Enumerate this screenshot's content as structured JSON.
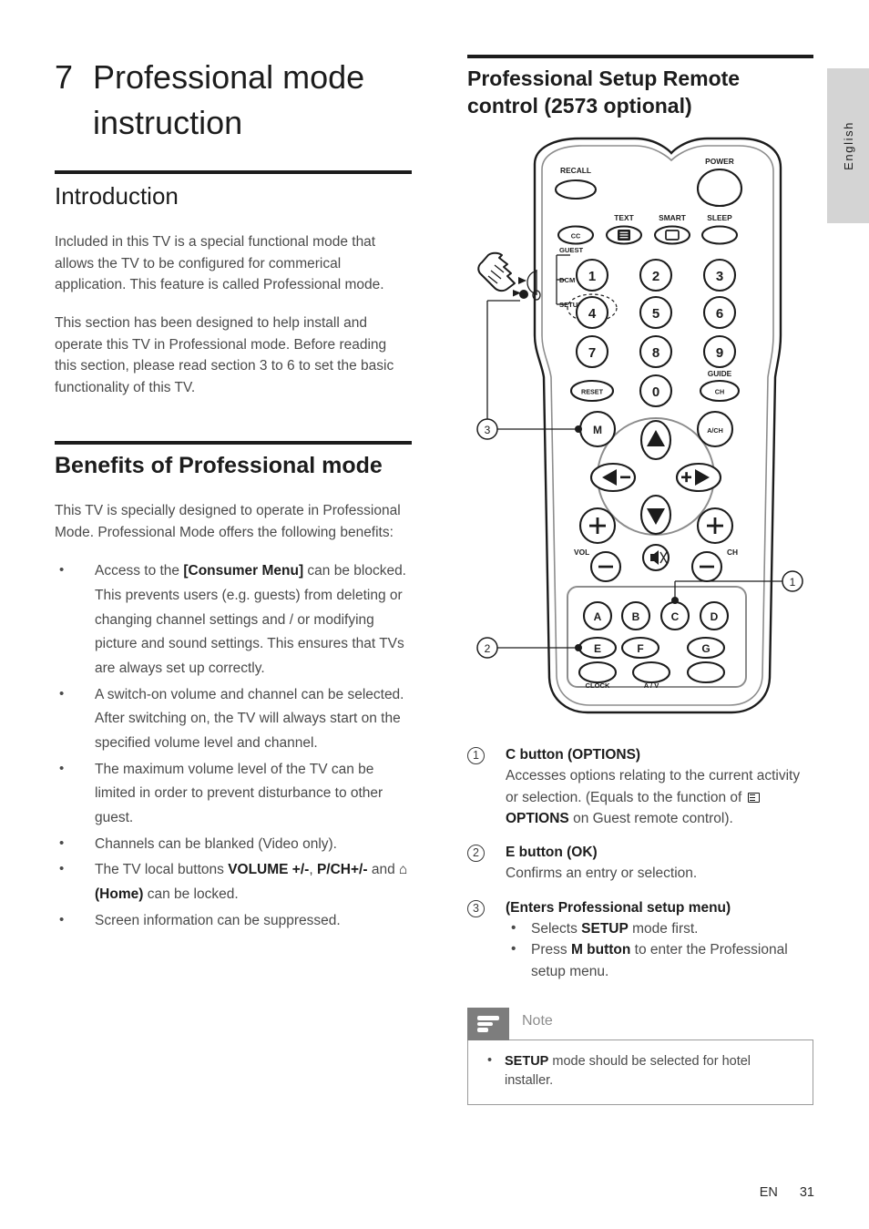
{
  "page": {
    "language_tab": "English",
    "footer": {
      "lang_code": "EN",
      "page_number": "31"
    }
  },
  "left_column": {
    "chapter": {
      "number": "7",
      "title": "Professional mode instruction"
    },
    "intro": {
      "heading": "Introduction",
      "paragraph_1": "Included in this TV is a special functional mode that allows the TV to be configured for commerical application. This feature is called Professional mode.",
      "paragraph_2": "This section has been designed to help install and operate this TV in Professional mode. Before reading this section, please read section 3 to 6 to set the basic functionality of this TV."
    },
    "benefits": {
      "heading": "Benefits of Professional mode",
      "paragraph": "This TV is specially designed to operate in Professional Mode. Professional Mode offers the following benefits:",
      "items": [
        {
          "parts": [
            {
              "t": "Access to the ",
              "b": false
            },
            {
              "t": "[Consumer Menu]",
              "b": true
            },
            {
              "t": " can be blocked.  This prevents users (e.g. guests) from deleting or changing channel settings and / or modifying picture and sound settings. This ensures that TVs are always set up correctly.",
              "b": false
            }
          ]
        },
        {
          "parts": [
            {
              "t": "A switch-on volume and channel can be selected.  After switching on, the TV will always start on the specified volume level and channel.",
              "b": false
            }
          ]
        },
        {
          "parts": [
            {
              "t": "The maximum volume level of the TV can be limited in order to prevent disturbance to other guest.",
              "b": false
            }
          ]
        },
        {
          "parts": [
            {
              "t": "Channels can be blanked (Video only).",
              "b": false
            }
          ]
        },
        {
          "parts": [
            {
              "t": "The TV local buttons ",
              "b": false
            },
            {
              "t": "VOLUME +/-",
              "b": true
            },
            {
              "t": ", ",
              "b": false
            },
            {
              "t": "P/CH+/-",
              "b": true
            },
            {
              "t": " and ",
              "b": false
            },
            {
              "t": "⌂",
              "b": true,
              "icon": "home-icon"
            },
            {
              "t": " (Home)",
              "b": true
            },
            {
              "t": " can be locked.",
              "b": false
            }
          ]
        },
        {
          "parts": [
            {
              "t": "Screen information can be suppressed.",
              "b": false
            }
          ]
        }
      ]
    }
  },
  "right_column": {
    "heading": "Professional Setup Remote control (2573 optional)",
    "remote": {
      "alt": "Professional setup remote control diagram",
      "top_labels": {
        "recall": "RECALL",
        "power": "POWER",
        "cc": "CC",
        "text": "TEXT",
        "smart": "SMART",
        "sleep": "SLEEP"
      },
      "switch_labels": [
        "GUEST",
        "DCM",
        "SETUP"
      ],
      "keypad": [
        "1",
        "2",
        "3",
        "4",
        "5",
        "6",
        "7",
        "8",
        "9",
        "RESET",
        "0",
        "CH"
      ],
      "guide_label": "GUIDE",
      "nav_labels": {
        "menu": "M",
        "achannel": "A/CH",
        "vol": "VOL",
        "ch": "CH"
      },
      "letter_buttons": [
        "A",
        "B",
        "C",
        "D",
        "E",
        "F",
        "G"
      ],
      "bottom_labels": {
        "clock": "CLOCK",
        "av": "A / V"
      },
      "callout_numbers": [
        "1",
        "2",
        "3"
      ]
    },
    "callouts": [
      {
        "num": "1",
        "title": "C button (OPTIONS)",
        "desc_before": "Accesses options relating to the current activity or selection. (Equals to the function of ",
        "desc_bold": "OPTIONS",
        "desc_after": " on Guest remote control).",
        "has_options_icon": true
      },
      {
        "num": "2",
        "title": "E button (OK)",
        "desc": "Confirms an entry or selection."
      },
      {
        "num": "3",
        "title": "(Enters Professional setup menu)",
        "sub_items": [
          {
            "parts": [
              {
                "t": "Selects ",
                "b": false
              },
              {
                "t": "SETUP",
                "b": true
              },
              {
                "t": " mode first.",
                "b": false
              }
            ]
          },
          {
            "parts": [
              {
                "t": "Press ",
                "b": false
              },
              {
                "t": "M button",
                "b": true
              },
              {
                "t": " to enter the Professional setup menu.",
                "b": false
              }
            ]
          }
        ]
      }
    ],
    "note": {
      "label": "Note",
      "items": [
        {
          "parts": [
            {
              "t": "SETUP",
              "b": true
            },
            {
              "t": " mode should be selected for hotel installer.",
              "b": false
            }
          ]
        }
      ]
    }
  },
  "colors": {
    "text_dark": "#1c1c1c",
    "text_body": "#4a4a4a",
    "rule": "#1c1c1c",
    "note_tab_bg": "#7d7d7d",
    "note_border": "#9a9a9a",
    "lang_tab_bg": "#d4d4d4"
  }
}
